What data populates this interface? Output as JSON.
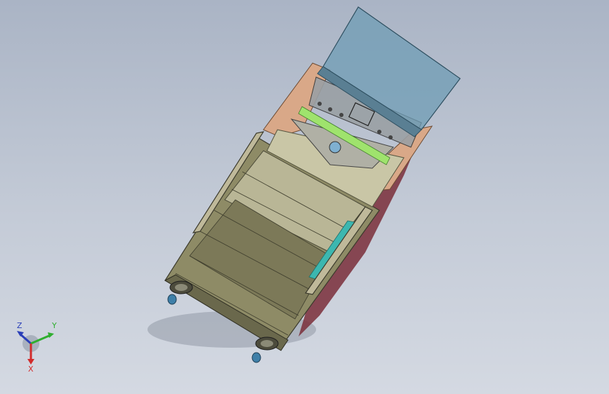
{
  "viewport": {
    "background_top": "#aab4c5",
    "background_bottom": "#d4d9e2"
  },
  "model": {
    "description_icon": "cad-assembly-machine-cabinet",
    "colors": {
      "hopper": "#6f9cb4",
      "frame_panel": "#d9a888",
      "side_panel_dark": "#7a2e3a",
      "body_olive": "#8e8b66",
      "body_light": "#c9c6a6",
      "accent_green": "#9fe36d",
      "accent_teal": "#3cb7b0",
      "caster": "#3e7fa8"
    }
  },
  "triad": {
    "x_label": "X",
    "y_label": "Y",
    "z_label": "Z",
    "x_color": "#d22b2b",
    "y_color": "#2fae2f",
    "z_color": "#2a3fb8"
  }
}
